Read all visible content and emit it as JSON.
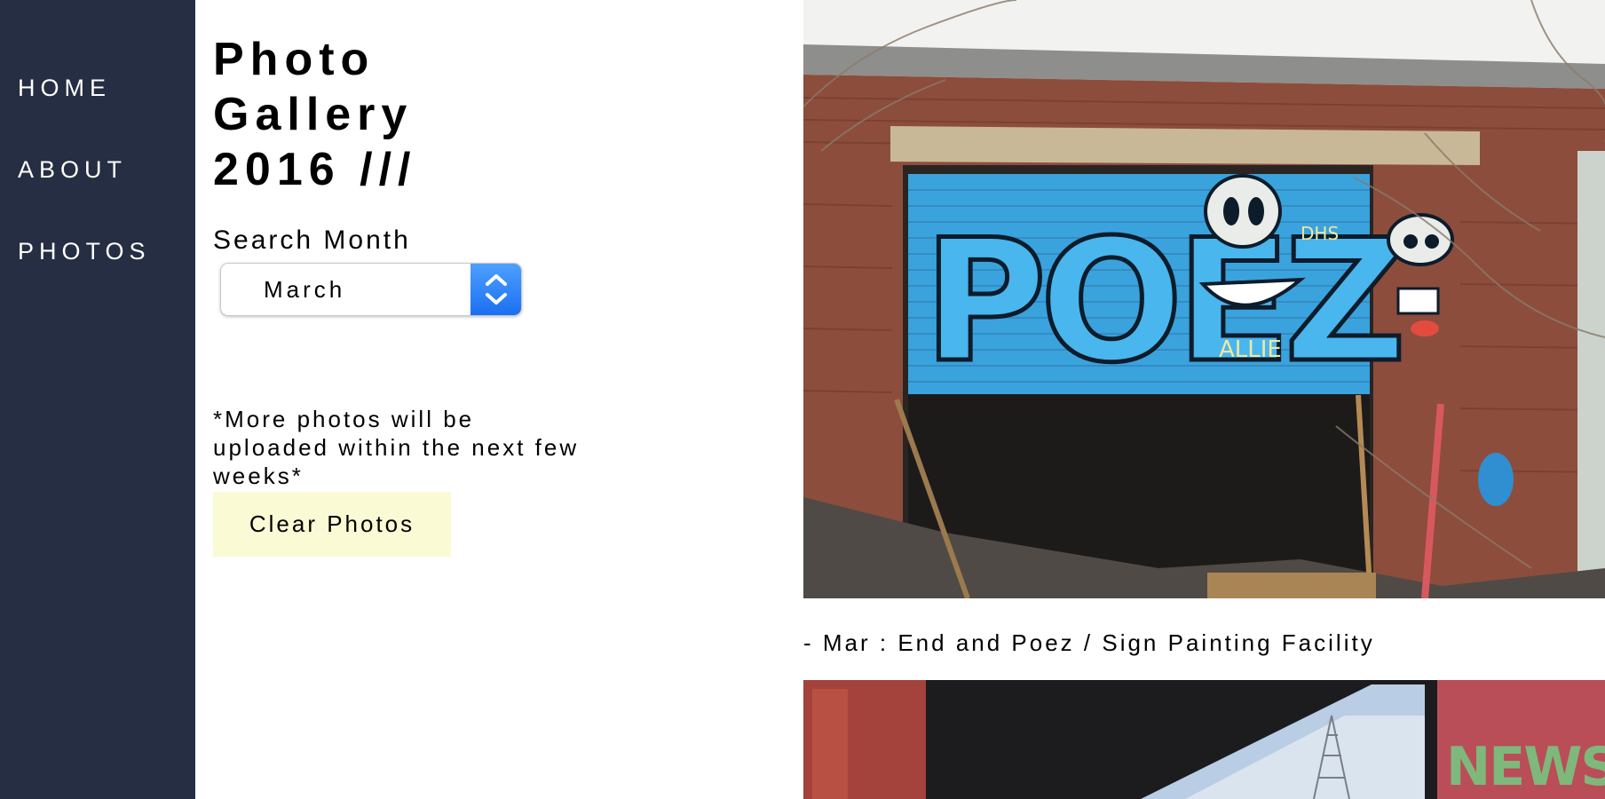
{
  "sidebar": {
    "items": [
      {
        "label": "HOME"
      },
      {
        "label": "ABOUT"
      },
      {
        "label": "PHOTOS"
      }
    ],
    "background": "#252e42"
  },
  "header": {
    "title_lines": [
      "Photo",
      "Gallery",
      "2016 ///"
    ]
  },
  "search": {
    "label": "Search Month",
    "selected": "March"
  },
  "note": "*More photos will be uploaded within the next few weeks*",
  "actions": {
    "clear_label": "Clear Photos",
    "clear_color": "#fafad5"
  },
  "gallery": {
    "photos": [
      {
        "caption": "- Mar : End and Poez / Sign Painting Facility",
        "graffiti_text": "POEZ",
        "graffiti_tag": "ALLIE",
        "graffiti_tag2": "DHS"
      },
      {
        "graffiti_text": "NEWSE"
      }
    ]
  }
}
